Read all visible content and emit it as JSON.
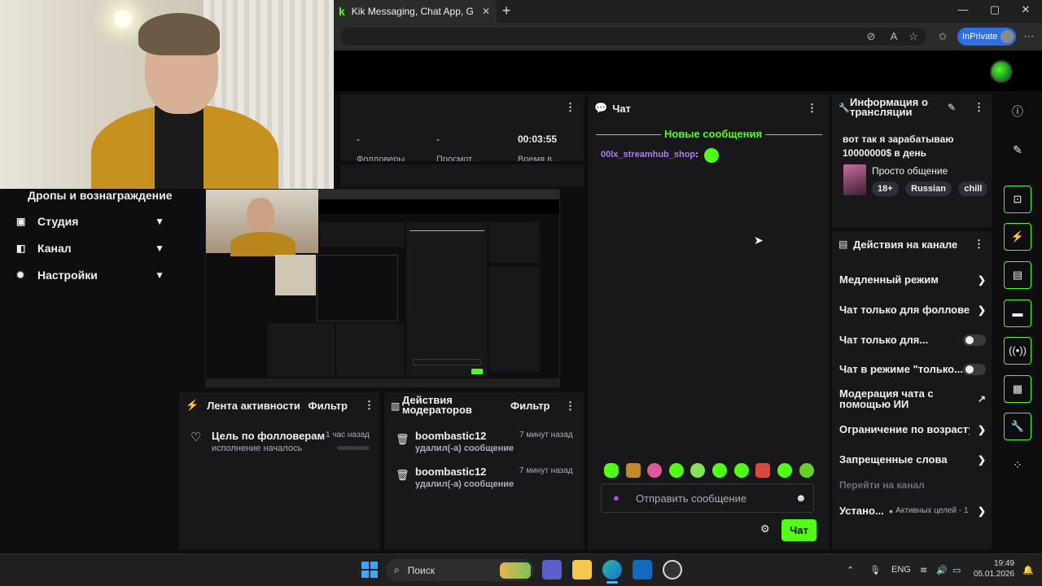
{
  "browser": {
    "tab_title": "Kik Messaging, Chat App, Groups...",
    "tab_close": "✕",
    "new_tab": "+",
    "inprivate_label": "InPrivate",
    "win_minimize": "—",
    "win_maximize": "▢",
    "win_close": "✕"
  },
  "sidebar": {
    "header": "Дропы и вознаграждение",
    "items": [
      {
        "label": "Студия",
        "icon": "studio-icon"
      },
      {
        "label": "Канал",
        "icon": "channel-icon"
      },
      {
        "label": "Настройки",
        "icon": "settings-icon"
      }
    ]
  },
  "stats": {
    "val1": "-",
    "val2": "-",
    "time": "00:03:55",
    "label1": "Фолловеры",
    "label2": "Просмот...",
    "label3": "Время в..."
  },
  "activity": {
    "title": "Лента активности",
    "filter": "Фильтр",
    "items": [
      {
        "name": "Цель по фолловерам",
        "sub": "исполнение началось",
        "time": "1 час назад"
      }
    ]
  },
  "modactions": {
    "title": "Действия модераторов",
    "filter": "Фильтр",
    "items": [
      {
        "name": "boombastic12",
        "sub": "удалил(-а) сообщение",
        "time": "7 минут назад"
      },
      {
        "name": "boombastic12",
        "sub": "удалил(-а) сообщение",
        "time": "7 минут назад"
      }
    ]
  },
  "chat": {
    "title": "Чат",
    "new_messages": "Новые сообщения",
    "messages": [
      {
        "user": "00lx_streamhub_shop",
        "sep": ":"
      }
    ],
    "input_placeholder": "Отправить сообщение",
    "send_label": "Чат"
  },
  "stream_info": {
    "title": "Информация о трансляции",
    "stream_title": "вот так я зарабатываю 10000000$ в день",
    "category": "Просто общение",
    "tags": [
      "18+",
      "Russian",
      "chill"
    ]
  },
  "channel_actions": {
    "title": "Действия на канале",
    "rows": [
      {
        "label": "Медленный режим",
        "control": "chevron"
      },
      {
        "label": "Чат только для фолловеро",
        "control": "chevron"
      },
      {
        "label": "Чат только для...",
        "control": "toggle"
      },
      {
        "label": "Чат в режиме \"только...",
        "control": "toggle"
      },
      {
        "label": "Модерация чата с помощью ИИ",
        "control": "external"
      },
      {
        "label": "Ограничение по возрасту з",
        "control": "chevron"
      },
      {
        "label": "Запрещенные слова",
        "control": "chevron"
      }
    ],
    "goto_channel": "Перейти на канал",
    "goals_label": "Устано...",
    "goals_status": "Активных целей - 1"
  },
  "taskbar": {
    "search": "Поиск",
    "lang": "ENG",
    "time": "19:49",
    "date": "05.01.2026"
  },
  "colors": {
    "accent": "#53fc18",
    "panel": "#18181b",
    "background": "#0e0e10"
  }
}
